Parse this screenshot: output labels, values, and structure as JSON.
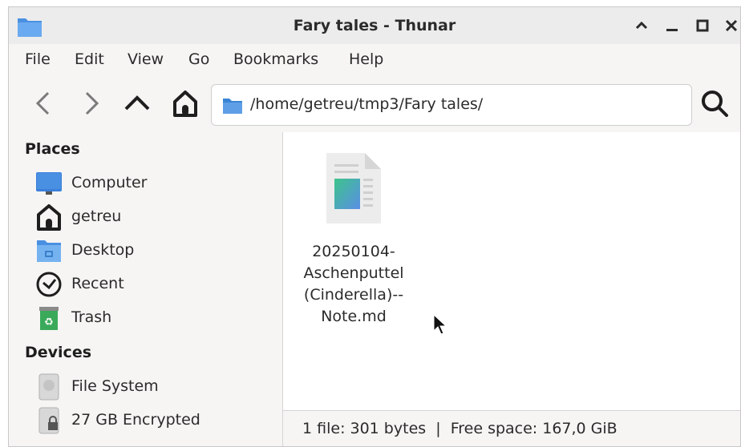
{
  "window": {
    "title": "Fary tales - Thunar",
    "controls": [
      "shade-icon",
      "minimize-icon",
      "maximize-icon",
      "close-icon"
    ]
  },
  "menu": {
    "items": [
      "File",
      "Edit",
      "View",
      "Go",
      "Bookmarks",
      "Help"
    ]
  },
  "toolbar": {
    "buttons": [
      "back-icon",
      "forward-icon",
      "parent-folder-icon",
      "home-icon"
    ],
    "location": "/home/getreu/tmp3/Fary tales/",
    "search_icon": "search-icon"
  },
  "sidebar": {
    "places_header": "Places",
    "places": [
      {
        "label": "Computer",
        "icon": "computer-icon"
      },
      {
        "label": "getreu",
        "icon": "home-icon"
      },
      {
        "label": "Desktop",
        "icon": "desktop-folder-icon"
      },
      {
        "label": "Recent",
        "icon": "clock-icon"
      },
      {
        "label": "Trash",
        "icon": "trash-icon"
      }
    ],
    "devices_header": "Devices",
    "devices": [
      {
        "label": "File System",
        "icon": "drive-icon"
      },
      {
        "label": "27 GB Encrypted",
        "icon": "encrypted-drive-icon"
      }
    ]
  },
  "files": [
    {
      "name": "20250104-Aschenputtel (Cinderella)--Note.md",
      "lines": [
        "20250104-",
        "Aschenputtel",
        "(Cinderella)--",
        "Note.md"
      ],
      "icon": "markdown-file-icon"
    }
  ],
  "status": {
    "text": "1 file: 301 bytes  |  Free space: 167,0 GiB"
  },
  "colors": {
    "accent_blue": "#3a84d6",
    "window_bg": "#f6f5f4",
    "titlebar_bg": "#ececec"
  }
}
